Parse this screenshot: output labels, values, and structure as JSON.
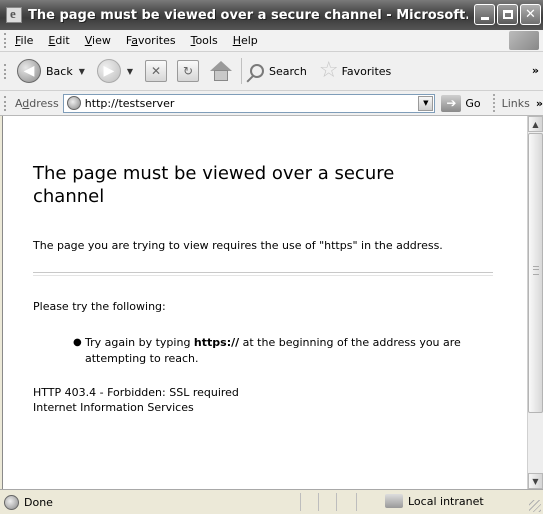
{
  "window": {
    "title": "The page must be viewed over a secure channel - Microsoft..."
  },
  "menu": {
    "items": [
      {
        "u": "F",
        "rest": "ile"
      },
      {
        "u": "E",
        "rest": "dit"
      },
      {
        "u": "V",
        "rest": "iew"
      },
      {
        "pre": "F",
        "u": "a",
        "rest": "vorites"
      },
      {
        "u": "T",
        "rest": "ools"
      },
      {
        "u": "H",
        "rest": "elp"
      }
    ]
  },
  "toolbar": {
    "back_label": "Back",
    "search_label": "Search",
    "favorites_label": "Favorites",
    "overflow": "»"
  },
  "address": {
    "label_pre": "A",
    "label_u": "d",
    "label_rest": "dress",
    "url": "http://testserver",
    "go_label": "Go",
    "links_label": "Links",
    "links_overflow": "»"
  },
  "page": {
    "heading": "The page must be viewed over a secure channel",
    "intro": "The page you are trying to view requires the use of \"https\" in the address.",
    "try_label": "Please try the following:",
    "bullet_pre": "Try again by typing ",
    "bullet_bold": "https://",
    "bullet_post": " at the beginning of the address you are attempting to reach.",
    "error_line": "HTTP 403.4 - Forbidden: SSL required",
    "server_line": "Internet Information Services"
  },
  "status": {
    "text": "Done",
    "zone": "Local intranet"
  }
}
